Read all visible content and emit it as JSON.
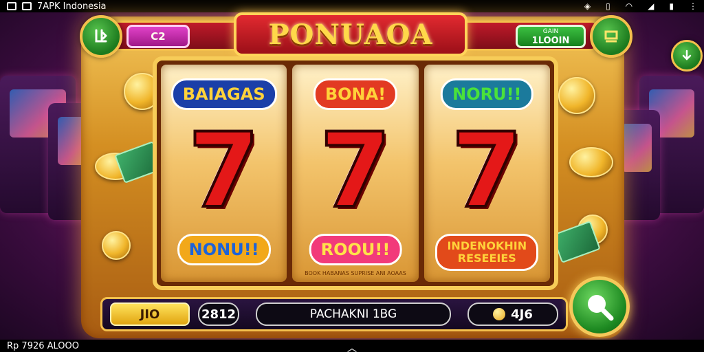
{
  "status_bar": {
    "app_title": "7APK Indonesia"
  },
  "nav_bar": {
    "left_text": "Rp 7926 ALOOO"
  },
  "machine": {
    "title": "PONUAOA",
    "credit_pill": "C2",
    "bet_pill_small": "GAIN",
    "bet_pill_value": "1LOOIN",
    "top_left_button_icon": "back-arrow-icon",
    "top_right_button_icon": "cart-icon",
    "side_button_icon": "refresh-icon"
  },
  "reels": [
    {
      "top_badge": "BAIAGAS",
      "top_badge_bg": "#1b3fa8",
      "top_badge_fg": "#ffd23a",
      "center_symbol": "7",
      "bottom_badge": "NONU!!",
      "bottom_badge_bg": "#f2a81a",
      "bottom_badge_fg": "#1d63d8"
    },
    {
      "top_badge": "BONA!",
      "top_badge_bg": "#e23a22",
      "top_badge_fg": "#ffd23a",
      "center_symbol": "7",
      "bottom_badge": "ROOU!!",
      "bottom_badge_bg": "#f23a7a",
      "bottom_badge_fg": "#ffe24a",
      "fineprint": "BOOK HABANAS SUPRISE ANI AOAAS"
    },
    {
      "top_badge": "NORU!!",
      "top_badge_bg": "#1b7a9c",
      "top_badge_fg": "#4ae23a",
      "center_symbol": "7",
      "bottom_badge": "INDENOKHIN RESEEIES",
      "bottom_badge_bg": "#e24a1a",
      "bottom_badge_fg": "#ffd23a"
    }
  ],
  "bottom_bar": {
    "field1": "JIO",
    "field2": "2812",
    "field3": "PACHAKNI 1BG",
    "field4": "4J6"
  },
  "spin_button": {
    "icon": "magnifier-spin-icon"
  }
}
